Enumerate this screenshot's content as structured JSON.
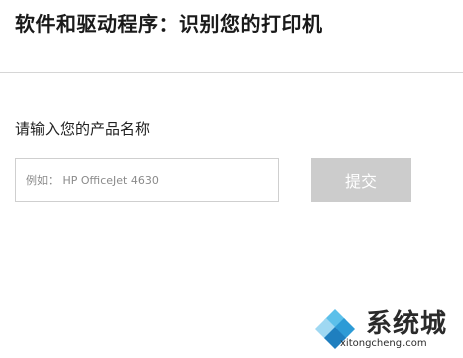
{
  "page": {
    "title": "软件和驱动程序：识别您的打印机"
  },
  "form": {
    "prompt": "请输入您的产品名称",
    "input_value": "",
    "input_placeholder": "例如： HP OfficeJet 4630",
    "submit_label": "提交",
    "submit_color": "#cccccc"
  },
  "watermark": {
    "name": "系统城",
    "domain": "xitongcheng.com",
    "logo_colors": [
      "#2d9bd6",
      "#5cc0ea",
      "#1f7fbf",
      "#9fd8f2"
    ]
  }
}
